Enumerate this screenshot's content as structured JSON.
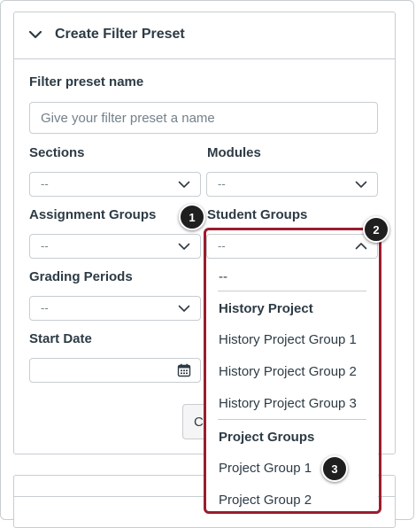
{
  "panel": {
    "title": "Create Filter Preset",
    "preset_name_label": "Filter preset name",
    "preset_name_placeholder": "Give your filter preset a name",
    "preset_name_value": ""
  },
  "filters": {
    "sections": {
      "label": "Sections",
      "value": "--"
    },
    "modules": {
      "label": "Modules",
      "value": "--"
    },
    "assignment_groups": {
      "label": "Assignment Groups",
      "value": "--"
    },
    "student_groups": {
      "label": "Student Groups",
      "value": "--"
    },
    "grading_periods": {
      "label": "Grading Periods",
      "value": "--"
    },
    "start_date": {
      "label": "Start Date",
      "value": ""
    }
  },
  "partial_button_label": "C",
  "student_groups_dropdown": {
    "none_option": "--",
    "groups": [
      {
        "name": "History Project",
        "options": [
          "History Project Group 1",
          "History Project Group 2",
          "History Project Group 3"
        ]
      },
      {
        "name": "Project Groups",
        "options": [
          "Project Group 1",
          "Project Group 2"
        ]
      }
    ]
  },
  "callouts": [
    "1",
    "2",
    "3"
  ],
  "colors": {
    "highlight": "#9b1c2e",
    "callout": "#1f1f1f",
    "border": "#c7cdd1",
    "text": "#2d3b45"
  }
}
